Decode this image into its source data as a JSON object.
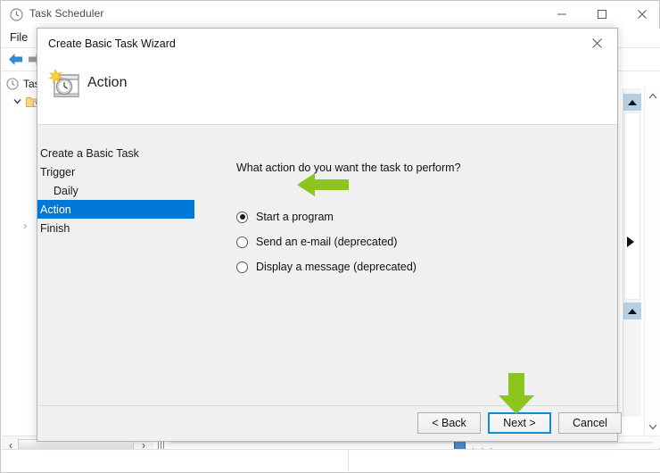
{
  "main_window": {
    "title": "Task Scheduler",
    "title_icon": "clock-icon",
    "controls": {
      "minimize": "─",
      "maximize": "□",
      "close": "✕"
    },
    "menubar": {
      "items": [
        {
          "label": "File"
        }
      ]
    },
    "toolbar": {
      "back_icon": "back-arrow-icon",
      "forward_icon": "forward-arrow-icon"
    },
    "tree": {
      "items": [
        {
          "label": "Tas",
          "icon": "clock-icon"
        },
        {
          "label": "",
          "icon": "folder-clock-icon",
          "chevron": "chevron-down-icon"
        }
      ],
      "expander": "›"
    },
    "scrollbars": {
      "up_arrow": "▲",
      "down_arrow": "▲",
      "left_arrow": "‹",
      "right_arrow": "›",
      "splitter": "▶",
      "outer_top_chevron": "˄",
      "outer_bottom_chevron": "˅"
    }
  },
  "dialog": {
    "title": "Create Basic Task Wizard",
    "close_label": "✕",
    "header": {
      "icon": "task-clock-icon",
      "heading": "Action"
    },
    "steps": [
      {
        "label": "Create a Basic Task",
        "indent": false,
        "active": false
      },
      {
        "label": "Trigger",
        "indent": false,
        "active": false
      },
      {
        "label": "Daily",
        "indent": true,
        "active": false
      },
      {
        "label": "Action",
        "indent": false,
        "active": true
      },
      {
        "label": "Finish",
        "indent": false,
        "active": false
      }
    ],
    "content": {
      "prompt": "What action do you want the task to perform?",
      "options": [
        {
          "label": "Start a program",
          "selected": true
        },
        {
          "label": "Send an e-mail (deprecated)",
          "selected": false
        },
        {
          "label": "Display a message (deprecated)",
          "selected": false
        }
      ]
    },
    "buttons": {
      "back": "< Back",
      "next": "Next >",
      "cancel": "Cancel"
    }
  },
  "annotations": {
    "color": "#8CC51E",
    "arrows": [
      {
        "name": "arrow-pointing-start-a-program",
        "direction": "left"
      },
      {
        "name": "arrow-pointing-next-button",
        "direction": "down"
      }
    ]
  }
}
